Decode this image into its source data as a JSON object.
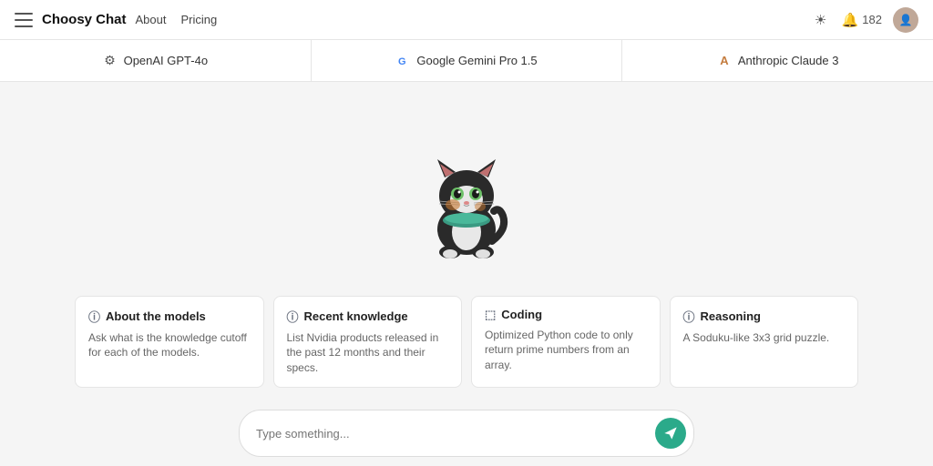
{
  "navbar": {
    "brand": "Choosy Chat",
    "nav_links": [
      {
        "label": "About"
      },
      {
        "label": "Pricing"
      }
    ],
    "notification_count": "182"
  },
  "models": [
    {
      "id": "openai",
      "label": "OpenAI GPT-4o",
      "icon_type": "openai"
    },
    {
      "id": "google",
      "label": "Google Gemini Pro 1.5",
      "icon_type": "google"
    },
    {
      "id": "anthropic",
      "label": "Anthropic Claude 3",
      "icon_type": "anthropic"
    }
  ],
  "suggestions": [
    {
      "id": "models",
      "icon": "ⓘ",
      "title": "About the models",
      "desc": "Ask what is the knowledge cutoff for each of the models."
    },
    {
      "id": "knowledge",
      "icon": "ⓘ",
      "title": "Recent knowledge",
      "desc": "List Nvidia products released in the past 12 months and their specs."
    },
    {
      "id": "coding",
      "icon": "⬚",
      "title": "Coding",
      "desc": "Optimized Python code to only return prime numbers from an array."
    },
    {
      "id": "reasoning",
      "icon": "ⓘ",
      "title": "Reasoning",
      "desc": "A Soduku-like 3x3 grid puzzle."
    }
  ],
  "input": {
    "placeholder": "Type something..."
  }
}
